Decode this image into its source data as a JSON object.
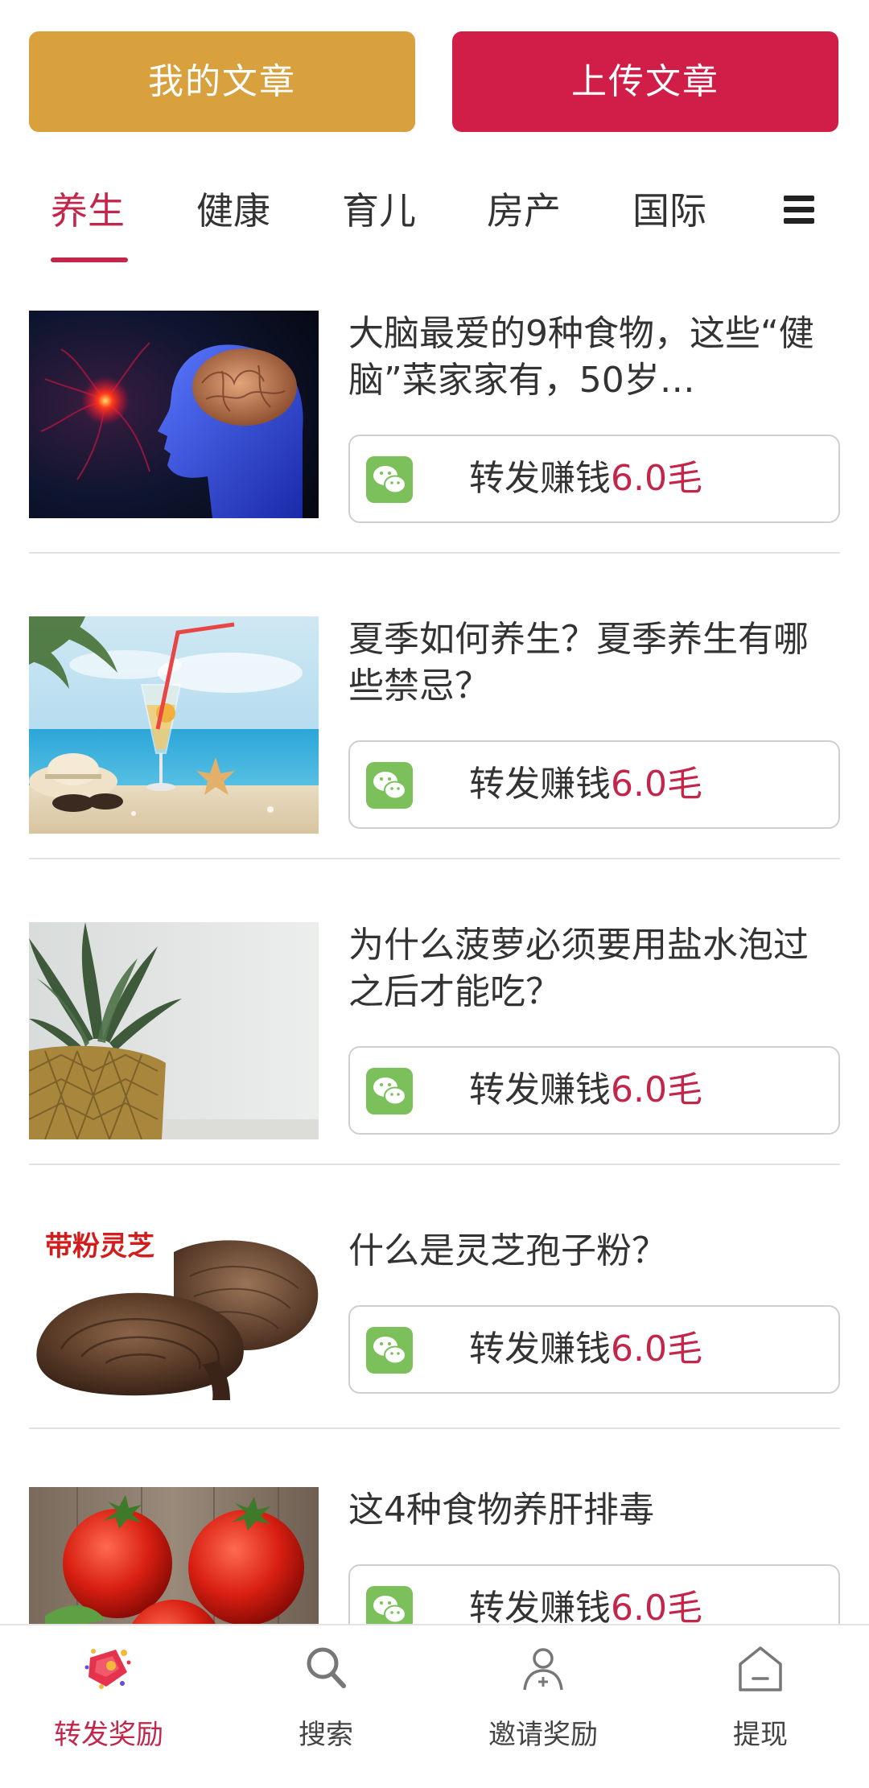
{
  "top_buttons": {
    "my_articles": "我的文章",
    "upload_article": "上传文章"
  },
  "tabs": [
    {
      "label": "养生",
      "active": true
    },
    {
      "label": "健康",
      "active": false
    },
    {
      "label": "育儿",
      "active": false
    },
    {
      "label": "房产",
      "active": false
    },
    {
      "label": "国际",
      "active": false
    }
  ],
  "menu_icon": "menu-icon",
  "articles": [
    {
      "title": "大脑最爱的9种食物，这些“健脑”菜家家有，50岁…",
      "share_label": "转发赚钱",
      "reward": "6.0毛",
      "image": "brain-head-image"
    },
    {
      "title": "夏季如何养生？夏季养生有哪些禁忌？",
      "share_label": "转发赚钱",
      "reward": "6.0毛",
      "image": "beach-drink-image"
    },
    {
      "title": "为什么菠萝必须要用盐水泡过之后才能吃？",
      "share_label": "转发赚钱",
      "reward": "6.0毛",
      "image": "pineapple-image"
    },
    {
      "title": "什么是灵芝孢子粉？",
      "share_label": "转发赚钱",
      "reward": "6.0毛",
      "image": "lingzhi-mushroom-image",
      "image_caption": "带粉灵芝"
    },
    {
      "title": "这4种食物养肝排毒",
      "share_label": "转发赚钱",
      "reward": "6.0毛",
      "image": "tomatoes-image"
    }
  ],
  "bottom_nav": [
    {
      "label": "转发奖励",
      "icon": "share-reward-icon",
      "active": true
    },
    {
      "label": "搜索",
      "icon": "search-icon",
      "active": false
    },
    {
      "label": "邀请奖励",
      "icon": "invite-user-icon",
      "active": false
    },
    {
      "label": "提现",
      "icon": "withdraw-home-icon",
      "active": false
    }
  ],
  "colors": {
    "brand_red": "#C2274B",
    "upload_button": "#D01E48",
    "my_articles_button": "#D8A13E",
    "wechat_green": "#7BC05A"
  }
}
